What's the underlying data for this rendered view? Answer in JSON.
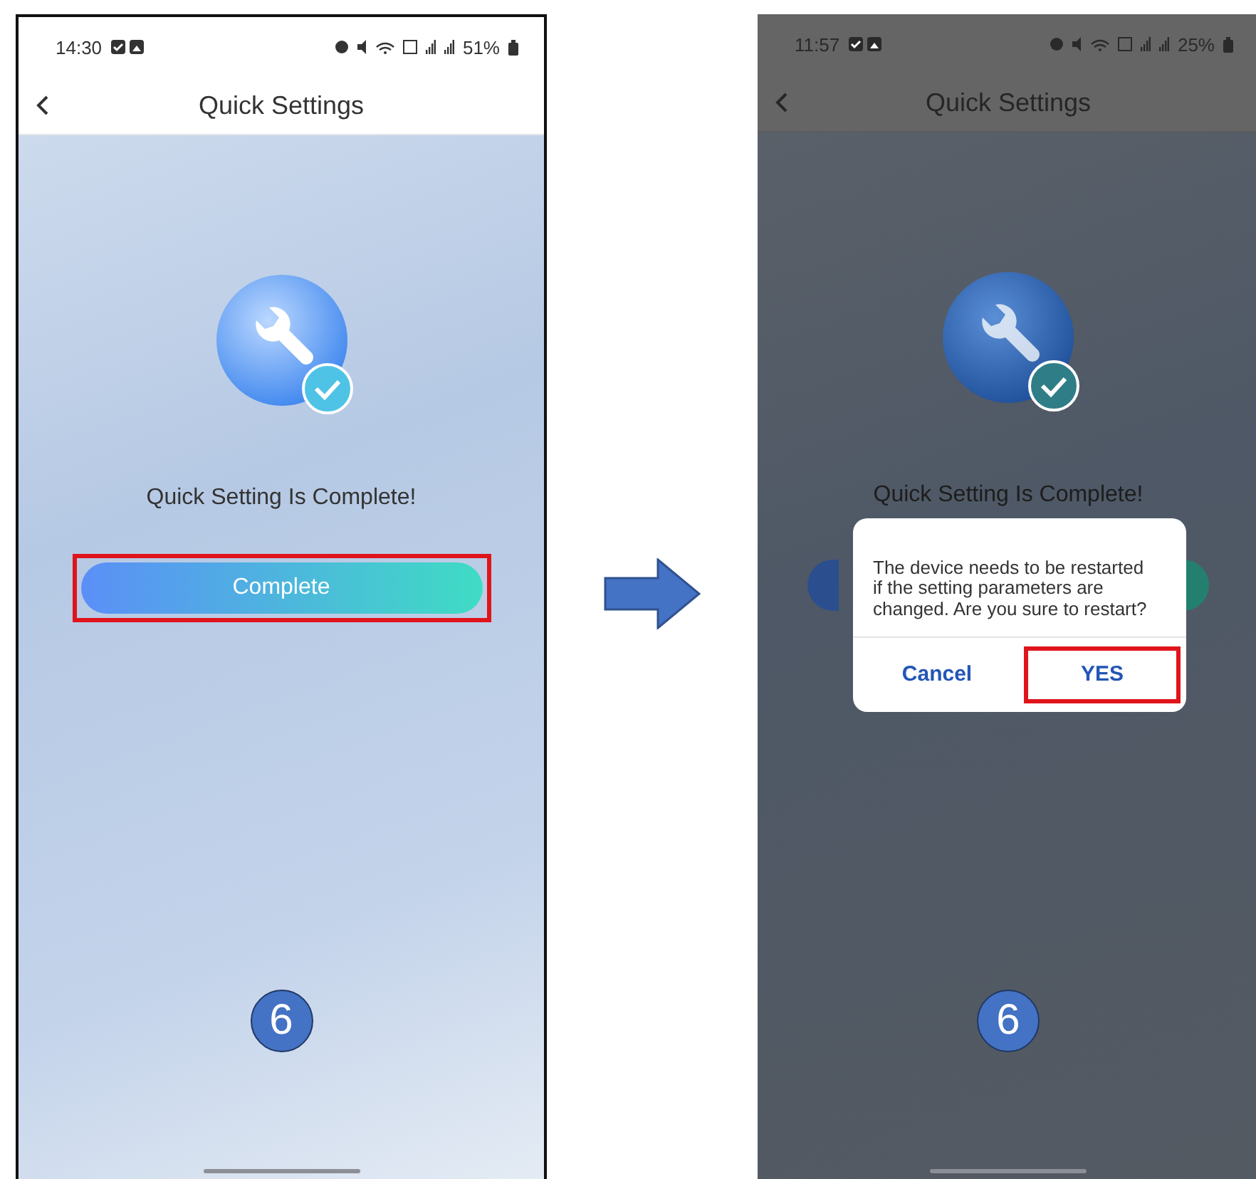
{
  "screens": [
    {
      "dimmed": false,
      "status_bar": {
        "time": "14:30",
        "battery": "51%"
      },
      "title": "Quick Settings",
      "message": "Quick Setting Is Complete!",
      "button": {
        "label": "Complete",
        "highlighted": true
      },
      "step": "6"
    },
    {
      "dimmed": true,
      "status_bar": {
        "time": "11:57",
        "battery": "25%"
      },
      "title": "Quick Settings",
      "message": "Quick Setting Is Complete!",
      "button": {
        "highlighted": false
      },
      "step": "6",
      "dialog": {
        "text": "The device needs to be restarted if the setting parameters are changed. Are you sure to restart?",
        "buttons": [
          {
            "label": "Cancel",
            "highlighted": false
          },
          {
            "label": "YES",
            "highlighted": true
          }
        ]
      }
    }
  ]
}
